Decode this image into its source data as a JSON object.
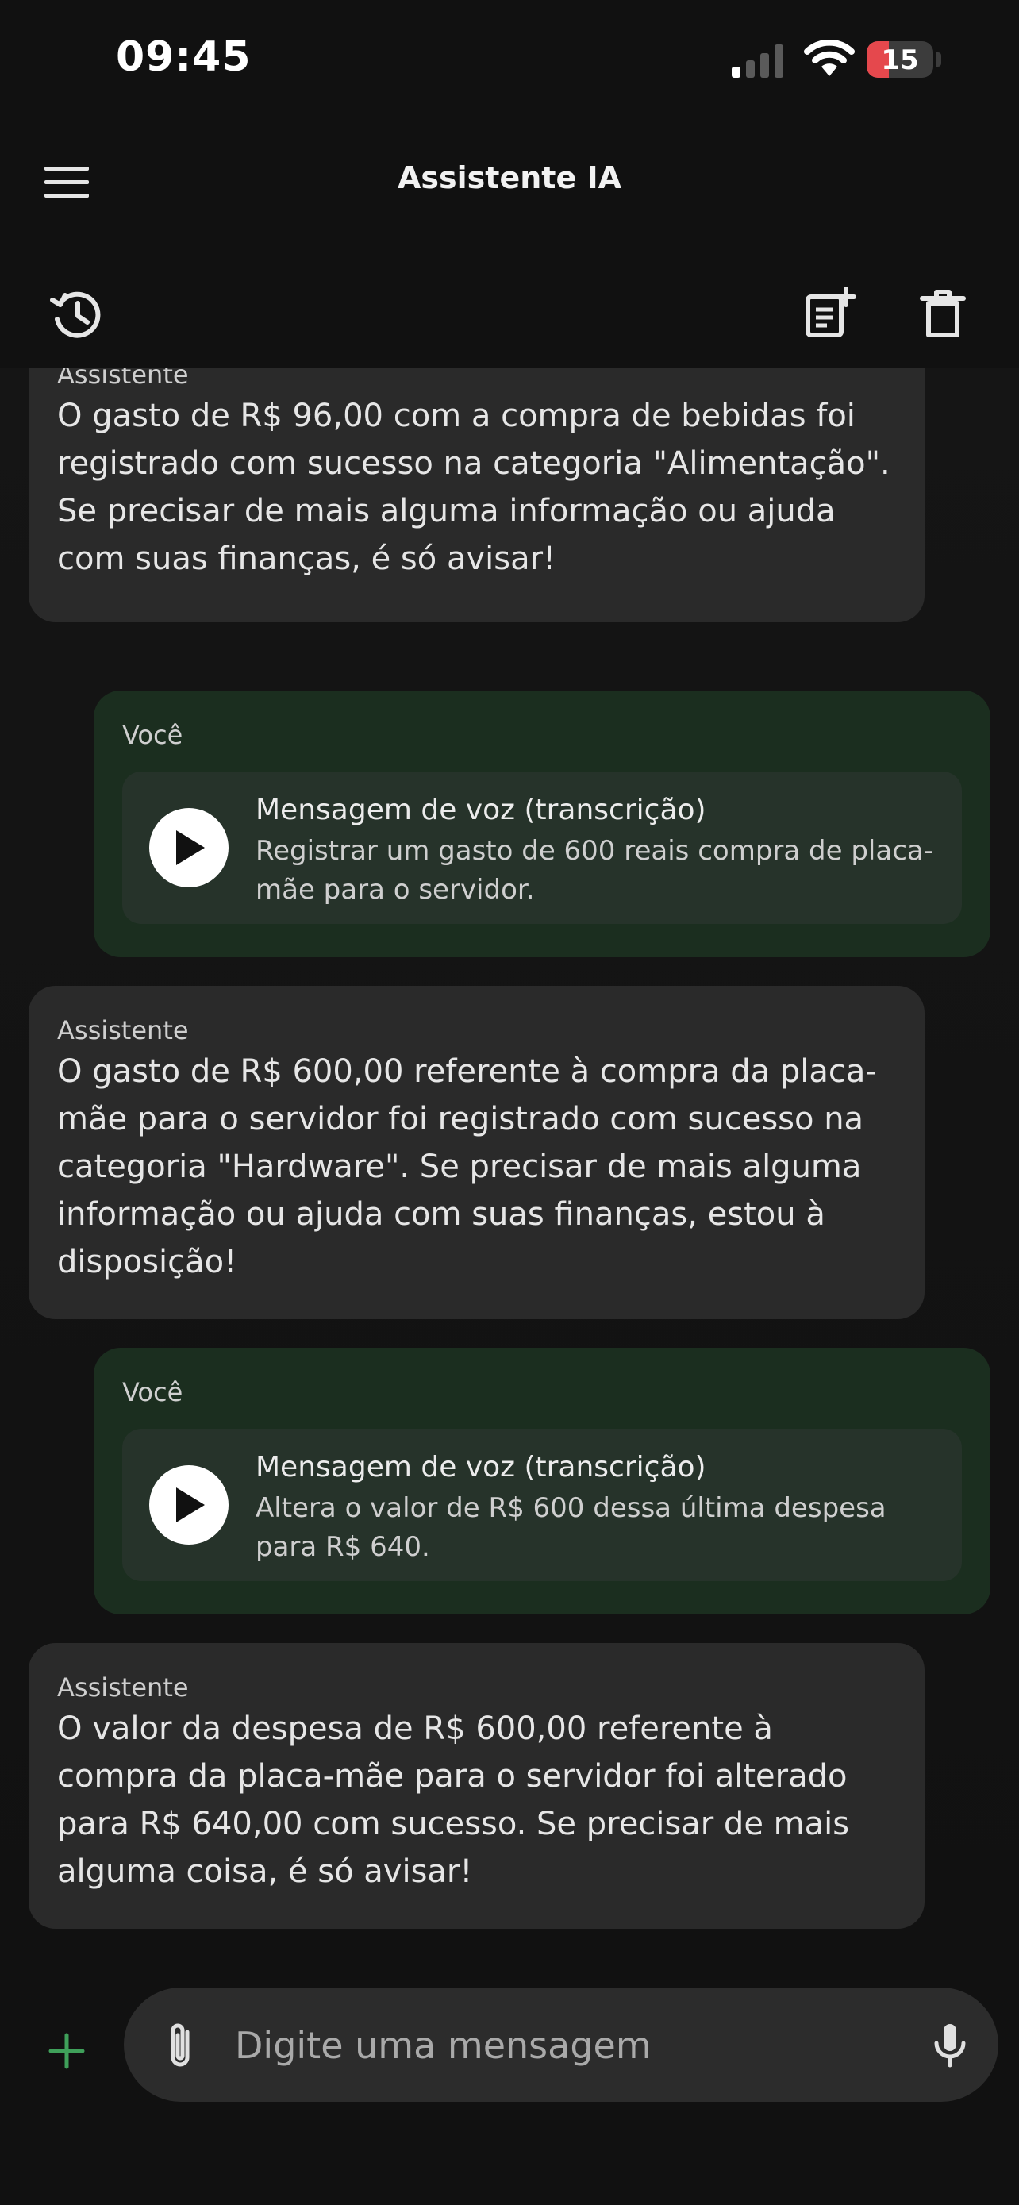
{
  "status_bar": {
    "time": "09:45",
    "battery_level": "15",
    "battery_fraction": 0.15
  },
  "app_bar": {
    "title": "Assistente IA",
    "icons": [
      "menu-icon",
      "history-icon",
      "new-note-icon",
      "trash-icon"
    ]
  },
  "messages": [
    {
      "role": "assistant",
      "sender": "Assistente",
      "text": "O gasto de R$ 96,00 com a compra de bebidas foi registrado com sucesso na categoria \"Alimentação\". Se precisar de mais alguma informação ou ajuda com suas finanças, é só avisar!"
    },
    {
      "role": "user",
      "sender": "Você",
      "voice_title": "Mensagem de voz (transcrição)",
      "text": "Registrar um gasto de 600 reais compra de placa-mãe para o servidor."
    },
    {
      "role": "assistant",
      "sender": "Assistente",
      "text": "O gasto de R$ 600,00 referente à compra da placa-mãe para o servidor foi registrado com sucesso na categoria \"Hardware\". Se precisar de mais alguma informação ou ajuda com suas finanças, estou à disposição!"
    },
    {
      "role": "user",
      "sender": "Você",
      "voice_title": "Mensagem de voz (transcrição)",
      "text": "Altera o valor de R$ 600 dessa última despesa para R$ 640."
    },
    {
      "role": "assistant",
      "sender": "Assistente",
      "text": "O valor da despesa de R$ 600,00 referente à compra da placa-mãe para o servidor foi alterado para R$ 640,00 com sucesso. Se precisar de mais alguma coisa, é só avisar!"
    }
  ],
  "input_bar": {
    "placeholder": "Digite uma mensagem",
    "value": ""
  },
  "colors": {
    "accent_green": "#3fa05a",
    "user_bubble": "#1b2e1f",
    "assistant_bubble": "#2a2a2a",
    "battery_low": "#e5484d"
  }
}
